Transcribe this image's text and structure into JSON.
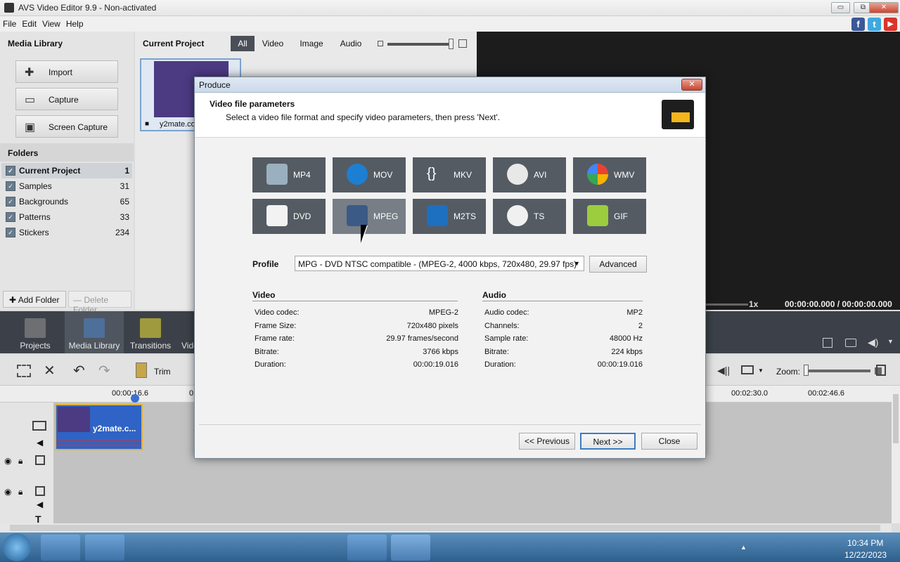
{
  "window": {
    "title": "AVS Video Editor 9.9 - Non-activated",
    "min": "▭",
    "max": "⧉",
    "close": "✕"
  },
  "menu": [
    "File",
    "Edit",
    "View",
    "Help"
  ],
  "social": {
    "facebook": "f",
    "twitter": "t",
    "youtube": "▶"
  },
  "media_library": {
    "title": "Media Library",
    "buttons": [
      {
        "label": "Import",
        "icon": "plus-icon"
      },
      {
        "label": "Capture",
        "icon": "camera-icon"
      },
      {
        "label": "Screen Capture",
        "icon": "screen-icon"
      }
    ],
    "folders_title": "Folders",
    "folders": [
      {
        "name": "Current Project",
        "count": "1"
      },
      {
        "name": "Samples",
        "count": "31"
      },
      {
        "name": "Backgrounds",
        "count": "65"
      },
      {
        "name": "Patterns",
        "count": "33"
      },
      {
        "name": "Stickers",
        "count": "234"
      }
    ],
    "add_folder": "Add Folder",
    "delete_folder": "Delete Folder"
  },
  "current_project": {
    "title": "Current Project",
    "filters": [
      "All",
      "Video",
      "Image",
      "Audio"
    ],
    "thumb_label": "y2mate.co"
  },
  "player": {
    "speed": "1x",
    "time": "00:00:00.000 / 00:00:00.000"
  },
  "nav": [
    "Projects",
    "Media Library",
    "Transitions",
    "Vide"
  ],
  "timeline": {
    "trim": "Trim",
    "zoom": "Zoom:",
    "ruler": [
      "00:00:16.6",
      "0",
      "00:02:30.0",
      "00:02:46.6"
    ],
    "clip_label": "y2mate.c..."
  },
  "dialog": {
    "title": "Produce",
    "heading": "Video file parameters",
    "subheading": "Select a video file format and specify video parameters, then press 'Next'.",
    "formats": [
      "MP4",
      "MOV",
      "MKV",
      "AVI",
      "WMV",
      "DVD",
      "MPEG",
      "M2TS",
      "TS",
      "GIF"
    ],
    "selected_format": "MPEG",
    "profile_label": "Profile",
    "profile_value": "MPG - DVD NTSC compatible - (MPEG-2, 4000 kbps, 720x480, 29.97 fps)",
    "advanced": "Advanced",
    "video_title": "Video",
    "video": [
      {
        "k": "Video codec:",
        "v": "MPEG-2"
      },
      {
        "k": "Frame Size:",
        "v": "720x480 pixels"
      },
      {
        "k": "Frame rate:",
        "v": "29.97 frames/second"
      },
      {
        "k": "Bitrate:",
        "v": "3766 kbps"
      },
      {
        "k": "Duration:",
        "v": "00:00:19.016"
      }
    ],
    "audio_title": "Audio",
    "audio": [
      {
        "k": "Audio codec:",
        "v": "MP2"
      },
      {
        "k": "Channels:",
        "v": "2"
      },
      {
        "k": "Sample rate:",
        "v": "48000 Hz"
      },
      {
        "k": "Bitrate:",
        "v": "224 kbps"
      },
      {
        "k": "Duration:",
        "v": "00:00:19.016"
      }
    ],
    "previous": "<< Previous",
    "next": "Next >>",
    "close": "Close"
  },
  "taskbar": {
    "time": "10:34 PM",
    "date": "12/22/2023"
  }
}
